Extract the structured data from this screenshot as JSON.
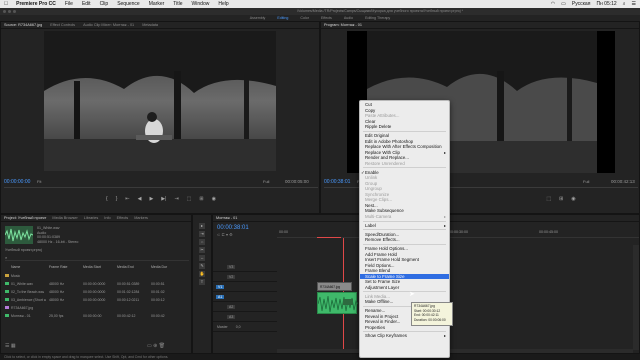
{
  "menubar": {
    "app_name": "Premiere Pro CC",
    "items": [
      "File",
      "Edit",
      "Clip",
      "Sequence",
      "Marker",
      "Title",
      "Window",
      "Help"
    ],
    "status_lang": "Русская",
    "status_time": "Пн 05:12"
  },
  "titlebar": {
    "path": "/Volumes/Media /TR/Projects/Camps/Сыщики/Мусорка для учебного проекта/Учебный проект.prproj *"
  },
  "workspaces": [
    "Assembly",
    "Editing",
    "Color",
    "Effects",
    "Audio",
    "Editing Тherapy"
  ],
  "workspace_active": "Editing",
  "source": {
    "tabs": [
      "Source: R734A667.jpg",
      "Effect Controls",
      "Audio Clip Mixer: Монтаж - 01",
      "Metadata"
    ],
    "timecode_left": "00:00:00:00",
    "fit": "Fit",
    "timecode_right": "00:00:05:00",
    "zoom": "Full"
  },
  "program": {
    "tab": "Program: Монтаж - 01",
    "timecode_left": "00:00:38:01",
    "fit": "Fit",
    "timecode_right": "00:00:42:13",
    "zoom": "Full"
  },
  "transport_controls": [
    "{",
    "}",
    "⇤",
    "◀",
    "▶",
    "▶|",
    "⇥",
    "⬚",
    "⊞",
    "◉"
  ],
  "project": {
    "tabs": [
      "Project: Учебный проект",
      "Media Browser",
      "Libraries",
      "Info",
      "Effects",
      "Markers"
    ],
    "clip_name": "01_White.wav",
    "clip_type": "Audio",
    "clip_duration": "00:00:51:0389",
    "clip_format": "48000 Hz - 16-bit - Stereo",
    "project_file": "Учебный проект.prproj",
    "columns": [
      "Name",
      "Frame Rate",
      "Media Start",
      "Media End",
      "Media Dur"
    ],
    "rows": [
      {
        "name": "Music",
        "rate": "",
        "start": "",
        "end": "",
        "dur": "",
        "color": "#c9a23d",
        "folder": true
      },
      {
        "name": "01_White.wav",
        "rate": "48000 Hz",
        "start": "00:00:00:0000",
        "end": "00:00:51:0389",
        "dur": "00:00:51",
        "color": "#3fb96a",
        "folder": false
      },
      {
        "name": "02_To the Beach.wav",
        "rate": "48000 Hz",
        "start": "00:00:00:0000",
        "end": "00:01:02:1284",
        "dur": "00:01:02",
        "color": "#3fb96a",
        "folder": false
      },
      {
        "name": "03_Ambience (Short w",
        "rate": "48000 Hz",
        "start": "00:00:00:0000",
        "end": "00:00:12:0211",
        "dur": "00:00:12",
        "color": "#3fb96a",
        "folder": false
      },
      {
        "name": "R734A667.jpg",
        "rate": "",
        "start": "",
        "end": "",
        "dur": "",
        "color": "#b57ad8",
        "folder": false
      },
      {
        "name": "Монтаж - 01",
        "rate": "25,00 fps",
        "start": "00:00:00:00",
        "end": "00:00:42:12",
        "dur": "00:00:42",
        "color": "#3fb96a",
        "folder": false
      }
    ]
  },
  "timeline": {
    "tab": "Монтаж - 01",
    "timecode": "00:00:38:01",
    "ruler": [
      "00:00",
      "00:00:15:00",
      "00:00:30:00",
      "00:00:45:00"
    ],
    "tracks": [
      {
        "name": "V3"
      },
      {
        "name": "V2"
      },
      {
        "name": "V1"
      },
      {
        "name": "A1"
      },
      {
        "name": "A2"
      },
      {
        "name": "A3"
      },
      {
        "name": "Master"
      }
    ],
    "master_value": "0,0",
    "video_clip": "R734A667.jpg",
    "tools": [
      "▸",
      "⇥",
      "⇔",
      "✂",
      "↔",
      "✎",
      "✋",
      "T"
    ]
  },
  "context_menu": {
    "items": [
      {
        "label": "Cut",
        "state": "normal"
      },
      {
        "label": "Copy",
        "state": "normal"
      },
      {
        "label": "Paste Attributes...",
        "state": "disabled"
      },
      {
        "label": "Clear",
        "state": "normal"
      },
      {
        "label": "Ripple Delete",
        "state": "normal"
      },
      {
        "sep": true
      },
      {
        "label": "Edit Original",
        "state": "normal"
      },
      {
        "label": "Edit in Adobe Photoshop",
        "state": "normal"
      },
      {
        "label": "Replace With After Effects Composition",
        "state": "normal"
      },
      {
        "label": "Replace With Clip",
        "state": "normal",
        "submenu": true
      },
      {
        "label": "Render and Replace...",
        "state": "normal"
      },
      {
        "label": "Restore Unrendered",
        "state": "disabled"
      },
      {
        "sep": true
      },
      {
        "label": "Enable",
        "state": "checked"
      },
      {
        "label": "Unlink",
        "state": "disabled"
      },
      {
        "label": "Group",
        "state": "disabled"
      },
      {
        "label": "Ungroup",
        "state": "disabled"
      },
      {
        "label": "Synchronize",
        "state": "disabled"
      },
      {
        "label": "Merge Clips...",
        "state": "disabled"
      },
      {
        "label": "Nest...",
        "state": "normal"
      },
      {
        "label": "Make Subsequence",
        "state": "normal"
      },
      {
        "label": "Multi-Camera",
        "state": "disabled",
        "submenu": true
      },
      {
        "sep": true
      },
      {
        "label": "Label",
        "state": "normal",
        "submenu": true
      },
      {
        "sep": true
      },
      {
        "label": "Speed/Duration...",
        "state": "normal"
      },
      {
        "label": "Remove Effects...",
        "state": "normal"
      },
      {
        "sep": true
      },
      {
        "label": "Frame Hold Options...",
        "state": "normal"
      },
      {
        "label": "Add Frame Hold",
        "state": "normal"
      },
      {
        "label": "Insert Frame Hold Segment",
        "state": "normal"
      },
      {
        "label": "Field Options...",
        "state": "normal"
      },
      {
        "label": "Frame Blend",
        "state": "normal"
      },
      {
        "label": "Scale to Frame Size",
        "state": "highlighted"
      },
      {
        "label": "Set to Frame Size",
        "state": "normal"
      },
      {
        "label": "Adjustment Layer",
        "state": "normal"
      },
      {
        "sep": true
      },
      {
        "label": "Link Media...",
        "state": "disabled"
      },
      {
        "label": "Make Offline...",
        "state": "normal"
      },
      {
        "sep": true
      },
      {
        "label": "Rename...",
        "state": "normal"
      },
      {
        "label": "Reveal in Project",
        "state": "normal"
      },
      {
        "label": "Reveal in Finder...",
        "state": "normal"
      },
      {
        "label": "Properties",
        "state": "normal"
      },
      {
        "sep": true
      },
      {
        "label": "Show Clip Keyframes",
        "state": "normal",
        "submenu": true
      }
    ]
  },
  "tooltip": {
    "lines": [
      "R734A667.jpg",
      "Start: 00:00:30:12",
      "End: 00:00:42:11",
      "Duration: 00:00:06:00"
    ]
  },
  "statusbar": {
    "text": "Click to select, or click in empty space and drag to marquee select. Use Shift, Opt, and Cmd for other options."
  },
  "colors": {
    "accent": "#4a9aff",
    "menu_highlight": "#2f6de2",
    "audio_clip": "#3fb96a",
    "video_clip": "#b57ad8",
    "playhead": "#e04848"
  }
}
